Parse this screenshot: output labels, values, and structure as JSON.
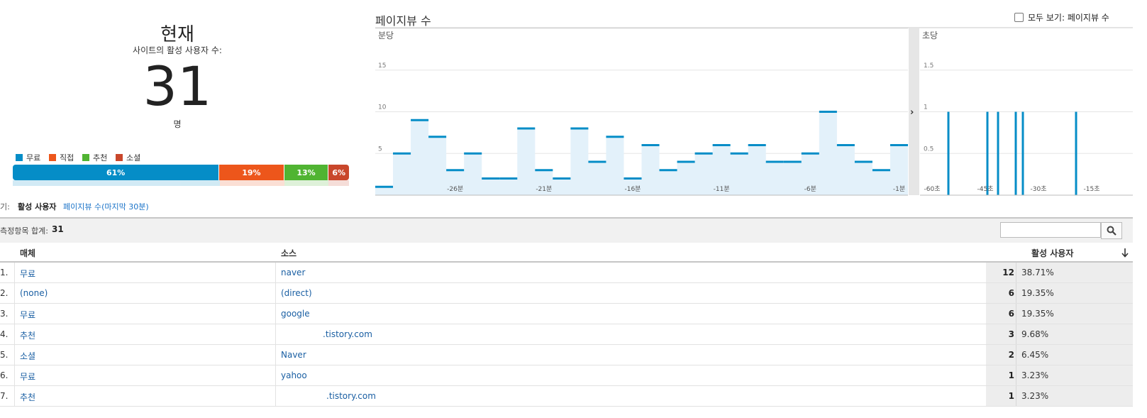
{
  "summary": {
    "title": "현재",
    "label": "사이트의 활성 사용자 수:",
    "count": "31",
    "unit": "명"
  },
  "traffic_breakdown": [
    {
      "name": "무료",
      "percent": 61,
      "label": "61%",
      "color": "#058dc7"
    },
    {
      "name": "직접",
      "percent": 19,
      "label": "19%",
      "color": "#ed561b"
    },
    {
      "name": "추천",
      "percent": 13,
      "label": "13%",
      "color": "#50b432"
    },
    {
      "name": "소셜",
      "percent": 6,
      "label": "6%",
      "color": "#c9472b"
    }
  ],
  "view_tabs": {
    "prefix": "보기:",
    "active": "활성 사용자",
    "pageviews": "페이지뷰 수(마지막 30분)"
  },
  "chart_header": {
    "title": "페이지뷰 수",
    "show_all_label": "모두 보기: 페이지뷰 수"
  },
  "chart_data": [
    {
      "type": "area",
      "title": "분당",
      "x_tick_labels": [
        "-26분",
        "-21분",
        "-16분",
        "-11분",
        "-6분",
        "-1분"
      ],
      "y_tick_labels": [
        "5",
        "10",
        "15"
      ],
      "ylim": [
        0,
        20
      ],
      "x": [
        -30,
        -29,
        -28,
        -27,
        -26,
        -25,
        -24,
        -23,
        -22,
        -21,
        -20,
        -19,
        -18,
        -17,
        -16,
        -15,
        -14,
        -13,
        -12,
        -11,
        -10,
        -9,
        -8,
        -7,
        -6,
        -5,
        -4,
        -3,
        -2,
        -1
      ],
      "values": [
        1,
        5,
        9,
        7,
        3,
        5,
        2,
        2,
        8,
        3,
        2,
        8,
        4,
        7,
        2,
        6,
        3,
        4,
        5,
        6,
        5,
        6,
        4,
        4,
        5,
        10,
        6,
        4,
        3,
        6
      ],
      "grid": true,
      "color": "#058dc7"
    },
    {
      "type": "bar",
      "title": "초당",
      "x_tick_labels": [
        "-60초",
        "-45초",
        "-30초",
        "-15초"
      ],
      "y_tick_labels": [
        "0.5",
        "1",
        "1.5"
      ],
      "ylim": [
        0,
        2
      ],
      "x": [
        -53,
        -42,
        -39,
        -34,
        -32,
        -17
      ],
      "values": [
        1,
        1,
        1,
        1,
        1,
        1
      ],
      "grid": true,
      "color": "#058dc7"
    }
  ],
  "table": {
    "total_label": "측정항목 합계:",
    "total_value": "31",
    "search_placeholder": "",
    "headers": {
      "medium": "매체",
      "source": "소스",
      "active_users": "활성 사용자"
    },
    "rows": [
      {
        "num": "1.",
        "medium": "무료",
        "source": "naver",
        "count": "12",
        "pct": "38.71%"
      },
      {
        "num": "2.",
        "medium": "(none)",
        "source": "(direct)",
        "count": "6",
        "pct": "19.35%"
      },
      {
        "num": "3.",
        "medium": "무료",
        "source": "google",
        "count": "6",
        "pct": "19.35%"
      },
      {
        "num": "4.",
        "medium": "추천",
        "source": ".tistory.com",
        "count": "3",
        "pct": "9.68%"
      },
      {
        "num": "5.",
        "medium": "소셜",
        "source": "Naver",
        "count": "2",
        "pct": "6.45%"
      },
      {
        "num": "6.",
        "medium": "무료",
        "source": "yahoo",
        "count": "1",
        "pct": "3.23%"
      },
      {
        "num": "7.",
        "medium": "추천",
        "source": ".tistory.com",
        "count": "1",
        "pct": "3.23%"
      }
    ]
  },
  "icons": {
    "search": "search-icon",
    "sort": "sort-down-arrow-icon",
    "expand": "chevron-right-icon"
  }
}
